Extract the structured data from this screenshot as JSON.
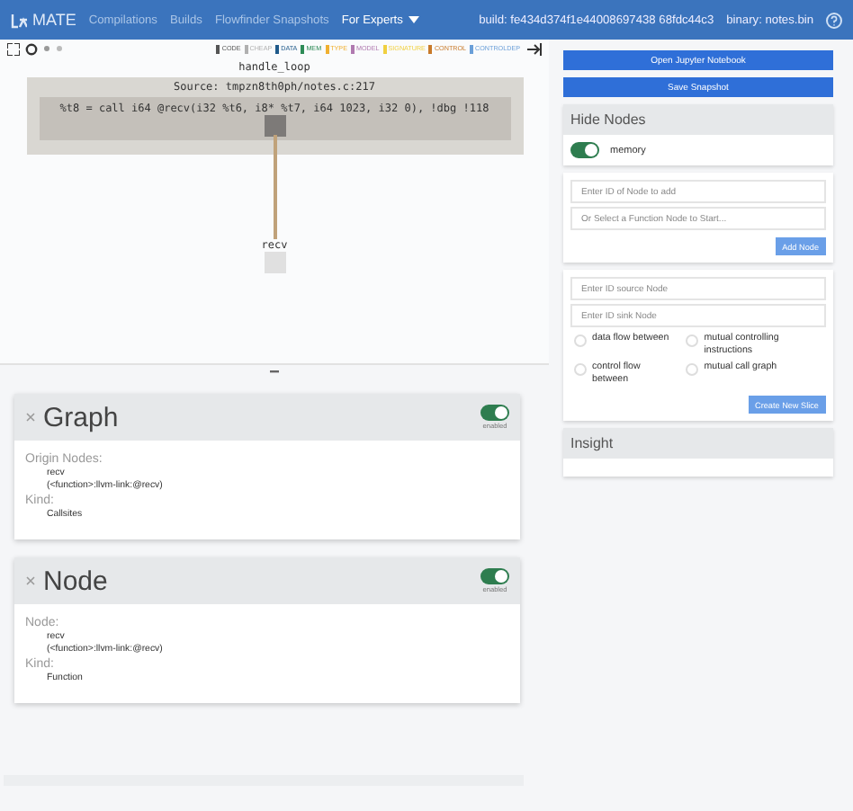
{
  "navbar": {
    "brand": "MATE",
    "links": [
      {
        "label": "Compilations",
        "kind": "link"
      },
      {
        "label": "Builds",
        "kind": "link"
      },
      {
        "label": "Flowfinder Snapshots",
        "kind": "link"
      },
      {
        "label": "For Experts",
        "kind": "dropdown"
      }
    ],
    "build": "build: fe434d374f1e44008697438 68fdc44c3",
    "binary": "binary: notes.bin"
  },
  "legend": [
    {
      "label": "CODE",
      "color": "#555555"
    },
    {
      "label": "CHEAP",
      "color": "#b0b0b0"
    },
    {
      "label": "DATA",
      "color": "#1f5a8a"
    },
    {
      "label": "MEM",
      "color": "#2e8b57"
    },
    {
      "label": "TYPE",
      "color": "#f0b030"
    },
    {
      "label": "MODEL",
      "color": "#b07ab0"
    },
    {
      "label": "SIGNATURE",
      "color": "#f0d040"
    },
    {
      "label": "CONTROL",
      "color": "#c87a2a"
    },
    {
      "label": "CONTROLDEP",
      "color": "#6a9fd8"
    }
  ],
  "graph": {
    "function": "handle_loop",
    "source": "Source: tmpzn8th0ph/notes.c:217",
    "instruction": "%t8 = call i64 @recv(i32 %t6, i8* %t7, i64 1023, i32 0), !dbg !118",
    "callee": "recv"
  },
  "cards": [
    {
      "title": "Graph",
      "enabled": true,
      "toggle_label": "enabled",
      "sections": [
        {
          "label": "Origin Nodes:",
          "lines": [
            "recv",
            "(<function>:llvm-link:@recv)"
          ]
        },
        {
          "label": "Kind:",
          "lines": [
            "Callsites"
          ]
        }
      ]
    },
    {
      "title": "Node",
      "enabled": true,
      "toggle_label": "enabled",
      "sections": [
        {
          "label": "Node:",
          "lines": [
            "recv",
            "(<function>:llvm-link:@recv)"
          ]
        },
        {
          "label": "Kind:",
          "lines": [
            "Function"
          ]
        }
      ]
    }
  ],
  "sidebar": {
    "buttons": [
      "Open Jupyter Notebook",
      "Save Snapshot"
    ],
    "hide_nodes": {
      "title": "Hide Nodes",
      "toggles": [
        {
          "label": "memory",
          "on": true
        }
      ]
    },
    "add_node": {
      "id_placeholder": "Enter ID of Node to add",
      "function_placeholder": "Or Select a Function Node to Start...",
      "button": "Add Node"
    },
    "slice": {
      "source_placeholder": "Enter ID source Node",
      "sink_placeholder": "Enter ID sink Node",
      "options": [
        {
          "label": "data flow between",
          "selected": false
        },
        {
          "label": "mutual controlling instructions",
          "selected": false
        },
        {
          "label": "control flow between",
          "selected": false
        },
        {
          "label": "mutual call graph",
          "selected": false
        }
      ],
      "button": "Create New Slice"
    },
    "insight": {
      "title": "Insight"
    }
  }
}
